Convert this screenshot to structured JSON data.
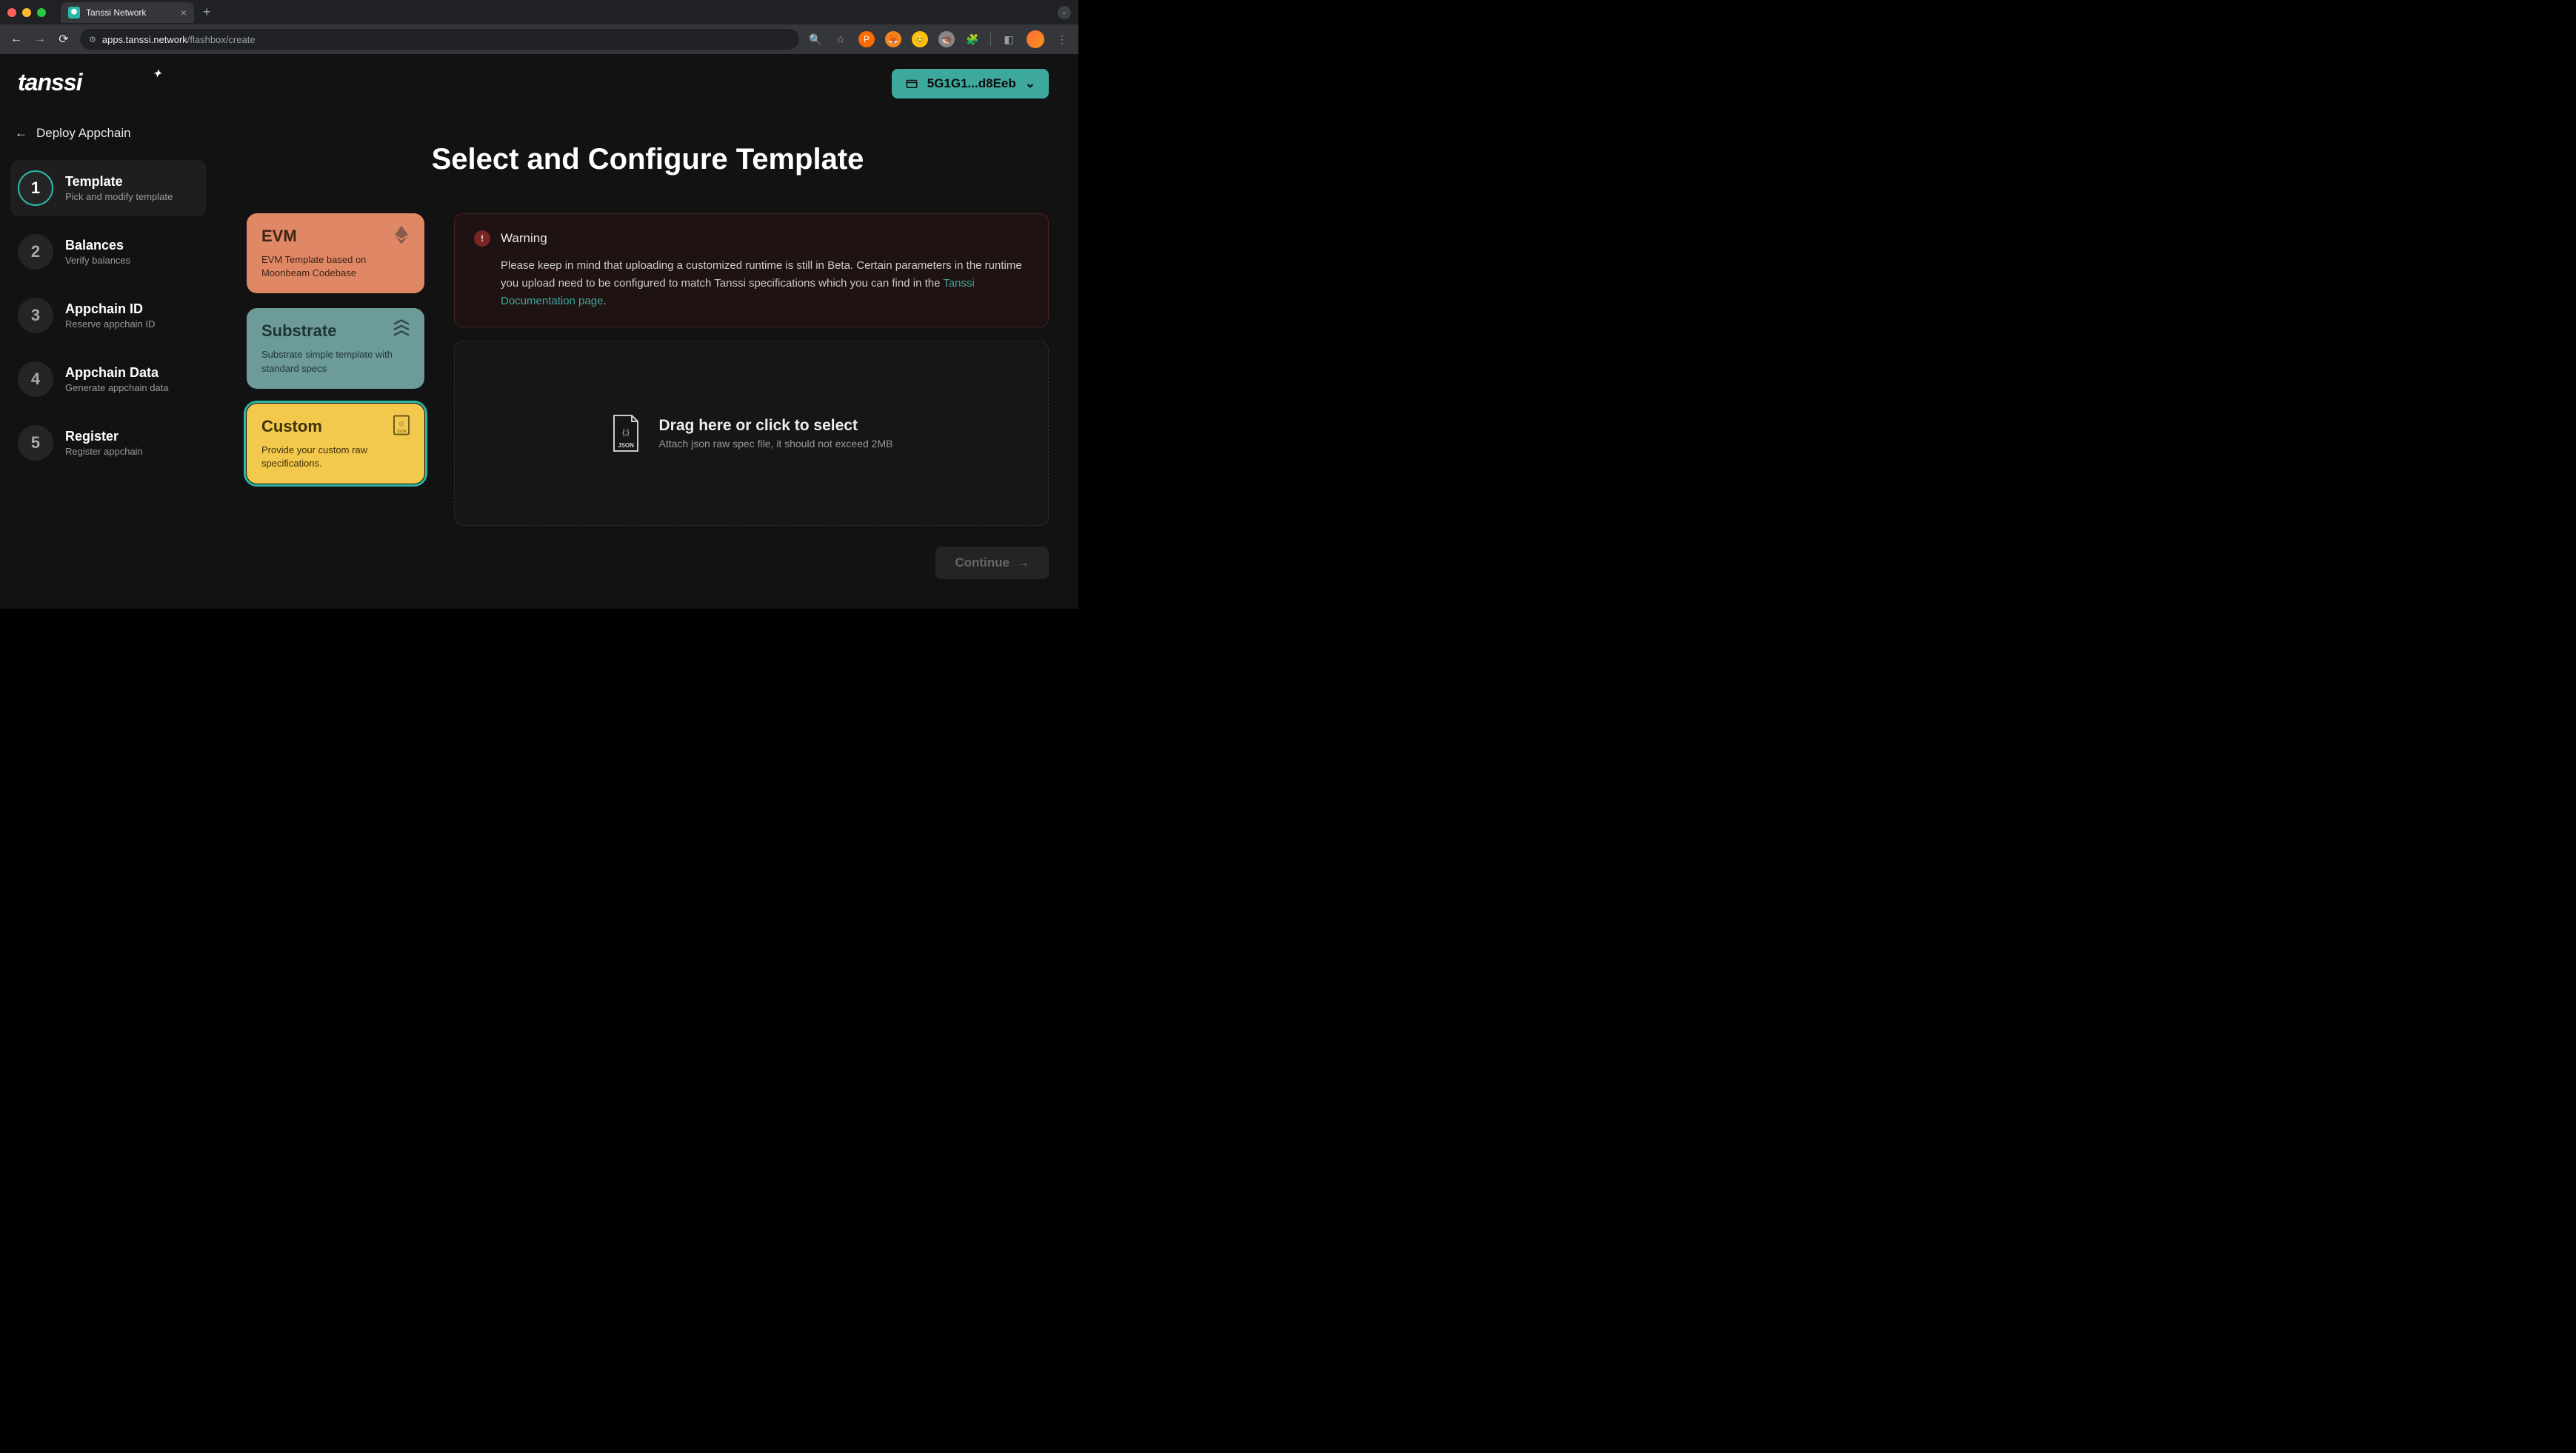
{
  "browser": {
    "tab_title": "Tanssi Network",
    "url_domain": "apps.tanssi.network",
    "url_path": "/flashbox/create"
  },
  "header": {
    "logo_text": "tanssi",
    "account_short": "5G1G1...d8Eeb"
  },
  "sidebar": {
    "back_label": "Deploy Appchain",
    "steps": [
      {
        "num": "1",
        "title": "Template",
        "subtitle": "Pick and modify template"
      },
      {
        "num": "2",
        "title": "Balances",
        "subtitle": "Verify balances"
      },
      {
        "num": "3",
        "title": "Appchain ID",
        "subtitle": "Reserve appchain ID"
      },
      {
        "num": "4",
        "title": "Appchain Data",
        "subtitle": "Generate appchain data"
      },
      {
        "num": "5",
        "title": "Register",
        "subtitle": "Register appchain"
      }
    ]
  },
  "main": {
    "page_title": "Select and Configure Template",
    "templates": [
      {
        "title": "EVM",
        "desc": "EVM Template based on Moonbeam Codebase"
      },
      {
        "title": "Substrate",
        "desc": "Substrate simple template with standard specs"
      },
      {
        "title": "Custom",
        "desc": "Provide your custom raw specifications."
      }
    ],
    "warning": {
      "title": "Warning",
      "text_before": "Please keep in mind that uploading a customized runtime is still in Beta. Certain parameters in the runtime you upload need to be configured to match Tanssi specifications which you can find in the ",
      "link_text": "Tanssi Documentation page",
      "text_after": "."
    },
    "dropzone": {
      "title": "Drag here or click to select",
      "subtitle": "Attach json raw spec file, it should not exceed 2MB"
    },
    "continue_label": "Continue"
  }
}
